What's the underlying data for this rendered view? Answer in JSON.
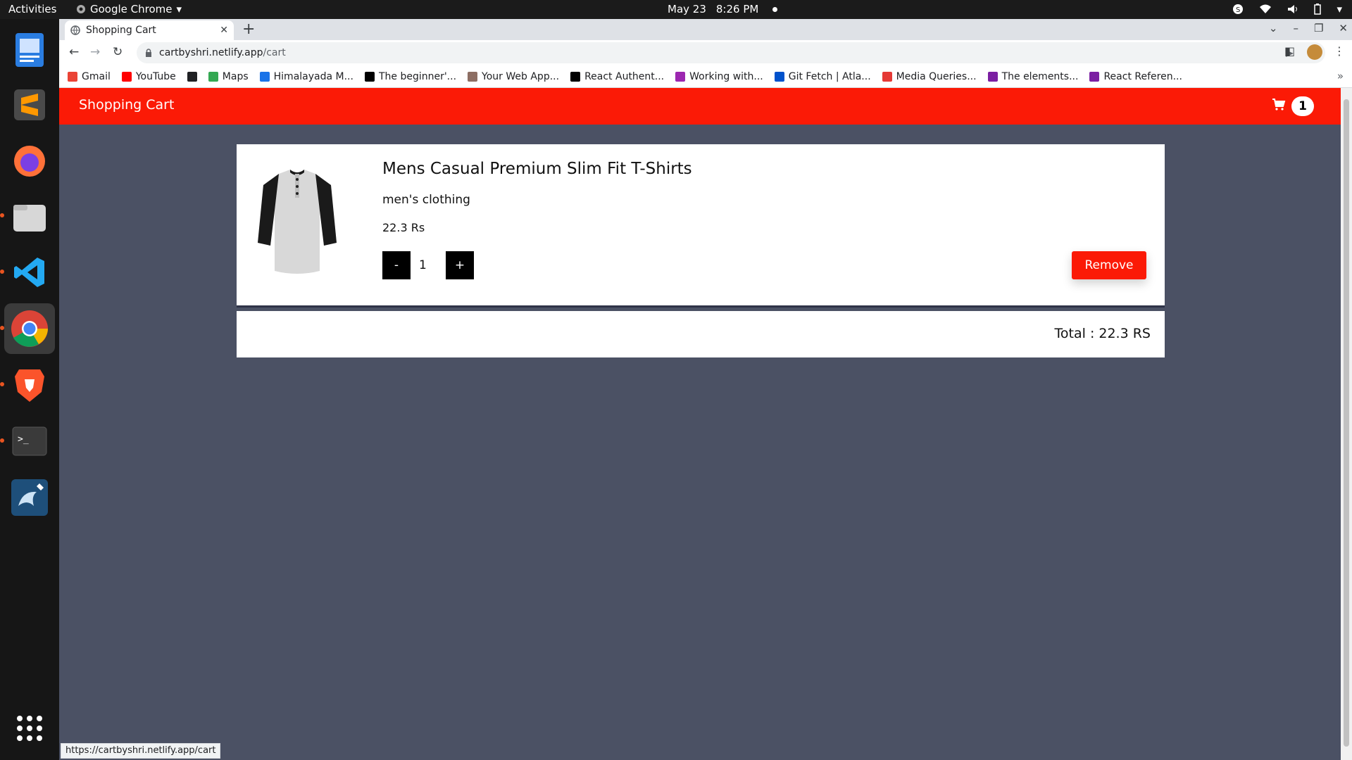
{
  "topbar": {
    "activities": "Activities",
    "app_name": "Google Chrome",
    "date": "May 23",
    "time": "8:26 PM"
  },
  "dock": {
    "items": [
      "text-editor-icon",
      "sublime-text-icon",
      "firefox-icon",
      "files-icon",
      "vscode-icon",
      "chrome-icon",
      "brave-icon",
      "terminal-icon",
      "mysql-workbench-icon",
      "app-grid-icon"
    ]
  },
  "browser": {
    "tab_title": "Shopping Cart",
    "url_host": "cartbyshri.netlify.app",
    "url_path": "/cart",
    "bookmarks": [
      {
        "label": "Gmail",
        "color": "#ea4335"
      },
      {
        "label": "YouTube",
        "color": "#ff0000"
      },
      {
        "label": "",
        "color": "#202124"
      },
      {
        "label": "Maps",
        "color": "#34a853"
      },
      {
        "label": "Himalayada M...",
        "color": "#1a73e8"
      },
      {
        "label": "The beginner'...",
        "color": "#000000"
      },
      {
        "label": "Your Web App...",
        "color": "#8d6e63"
      },
      {
        "label": "React Authent...",
        "color": "#000000"
      },
      {
        "label": "Working with...",
        "color": "#9c27b0"
      },
      {
        "label": "Git Fetch | Atla...",
        "color": "#0052cc"
      },
      {
        "label": "Media Queries...",
        "color": "#e53935"
      },
      {
        "label": "The elements...",
        "color": "#7b1fa2"
      },
      {
        "label": "React Referen...",
        "color": "#7b1fa2"
      }
    ],
    "status_url": "https://cartbyshri.netlify.app/cart"
  },
  "app": {
    "brand": "Shopping Cart",
    "cart_count": "1",
    "accent": "#fb1a06",
    "background": "#4b5164",
    "item": {
      "title": "Mens Casual Premium Slim Fit T-Shirts",
      "category": "men's clothing",
      "price": "22.3 Rs",
      "quantity": "1",
      "minus_label": "-",
      "plus_label": "+",
      "remove_label": "Remove"
    },
    "total": "Total : 22.3 RS"
  }
}
